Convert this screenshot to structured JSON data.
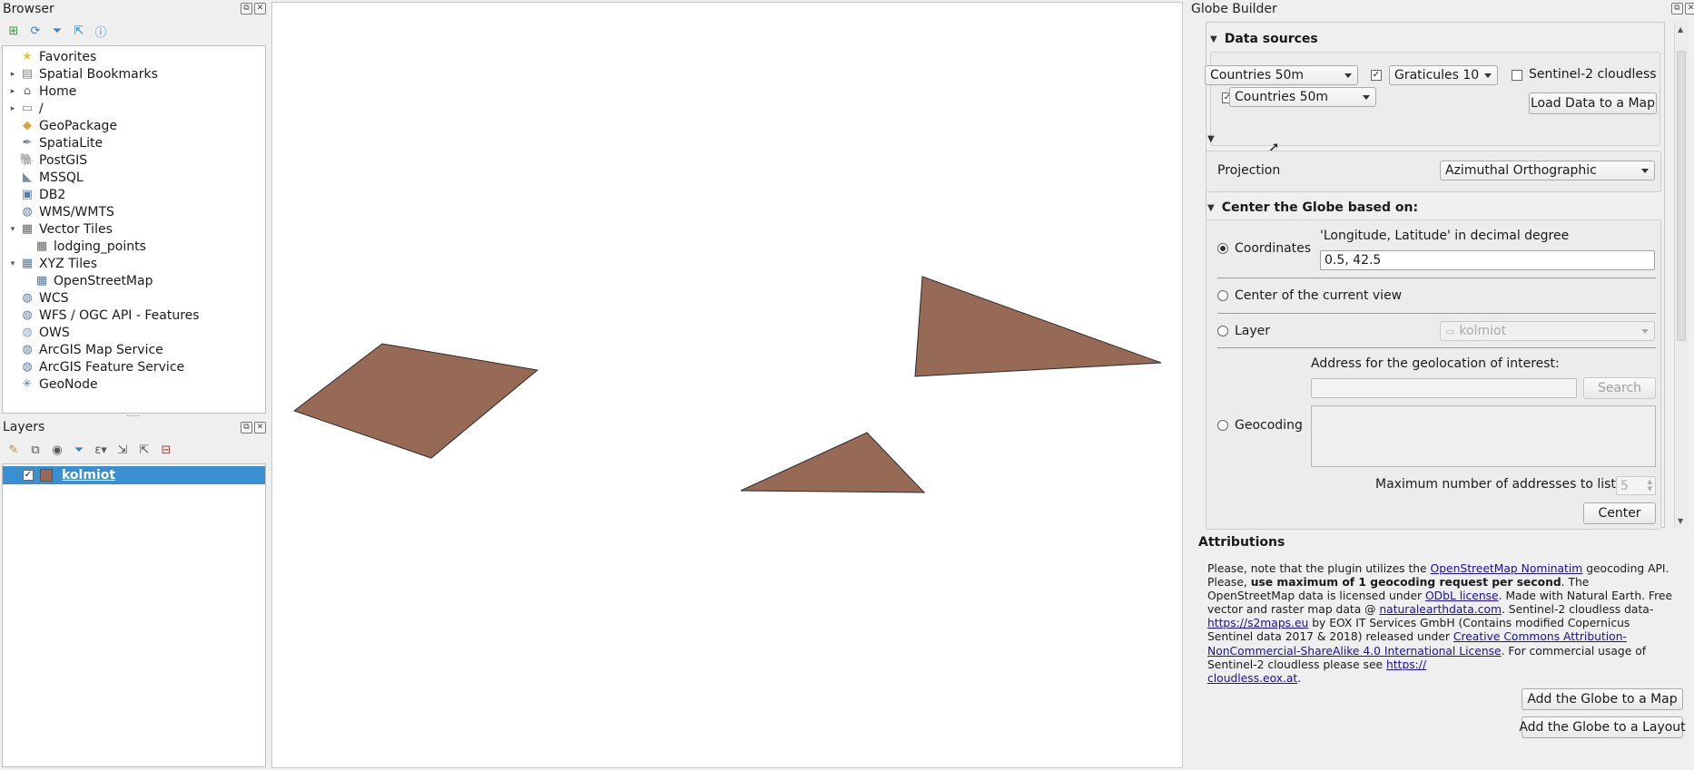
{
  "browser": {
    "title": "Browser",
    "items": [
      {
        "label": "Favorites",
        "icon": "star-icon",
        "glyph": "★",
        "color": "#e8c23a",
        "arrow": ""
      },
      {
        "label": "Spatial Bookmarks",
        "icon": "bookmark-icon",
        "glyph": "▤",
        "color": "#888",
        "arrow": "▸"
      },
      {
        "label": "Home",
        "icon": "home-icon",
        "glyph": "⌂",
        "color": "#666",
        "arrow": "▸"
      },
      {
        "label": "/",
        "icon": "folder-icon",
        "glyph": "▭",
        "color": "#888",
        "arrow": "▸"
      },
      {
        "label": "GeoPackage",
        "icon": "geopackage-icon",
        "glyph": "◆",
        "color": "#d9a441",
        "arrow": ""
      },
      {
        "label": "SpatiaLite",
        "icon": "spatialite-icon",
        "glyph": "✒",
        "color": "#6a7fa8",
        "arrow": ""
      },
      {
        "label": "PostGIS",
        "icon": "postgis-icon",
        "glyph": "🐘",
        "color": "#4a6b8f",
        "arrow": ""
      },
      {
        "label": "MSSQL",
        "icon": "mssql-icon",
        "glyph": "◣",
        "color": "#7a8aa0",
        "arrow": ""
      },
      {
        "label": "DB2",
        "icon": "db2-icon",
        "glyph": "▣",
        "color": "#5a7ca8",
        "arrow": ""
      },
      {
        "label": "WMS/WMTS",
        "icon": "wms-globe-icon",
        "glyph": "◍",
        "color": "#5b7a9c",
        "arrow": ""
      },
      {
        "label": "Vector Tiles",
        "icon": "vector-tiles-icon",
        "glyph": "▦",
        "color": "#666",
        "arrow": "▾"
      },
      {
        "label": "lodging_points",
        "icon": "vector-tile-layer-icon",
        "glyph": "▦",
        "color": "#666",
        "arrow": "",
        "indent": true
      },
      {
        "label": "XYZ Tiles",
        "icon": "xyz-tiles-icon",
        "glyph": "▦",
        "color": "#5b7a9c",
        "arrow": "▾"
      },
      {
        "label": "OpenStreetMap",
        "icon": "xyz-tile-layer-icon",
        "glyph": "▦",
        "color": "#5b7a9c",
        "arrow": "",
        "indent": true
      },
      {
        "label": "WCS",
        "icon": "wcs-globe-icon",
        "glyph": "◍",
        "color": "#5b7a9c",
        "arrow": ""
      },
      {
        "label": "WFS / OGC API - Features",
        "icon": "wfs-icon",
        "glyph": "◍",
        "color": "#5b7a9c",
        "arrow": ""
      },
      {
        "label": "OWS",
        "icon": "ows-globe-icon",
        "glyph": "◍",
        "color": "#8aa0b8",
        "arrow": ""
      },
      {
        "label": "ArcGIS Map Service",
        "icon": "arcgis-map-icon",
        "glyph": "◍",
        "color": "#5b7a9c",
        "arrow": ""
      },
      {
        "label": "ArcGIS Feature Service",
        "icon": "arcgis-feature-icon",
        "glyph": "◍",
        "color": "#5b7a9c",
        "arrow": ""
      },
      {
        "label": "GeoNode",
        "icon": "geonode-icon",
        "glyph": "✳",
        "color": "#5b7a9c",
        "arrow": ""
      }
    ]
  },
  "layers": {
    "title": "Layers",
    "items": [
      {
        "label": "kolmiot",
        "checked": true,
        "selected": true,
        "swatch": "#976a55"
      }
    ]
  },
  "map": {
    "polygon_fill": "#976a55",
    "polygon_stroke": "#2b2b2b"
  },
  "globe": {
    "title": "Globe Builder",
    "data_sources": {
      "heading": "Data sources",
      "countries": {
        "checked": true,
        "value": "Countries 50m"
      },
      "graticules": {
        "checked": true,
        "value": "Graticules 10"
      },
      "sentinel": {
        "checked": false,
        "label": "Sentinel-2 cloudless"
      },
      "load_button": "Load Data to a Map"
    },
    "projection": {
      "label": "Projection",
      "value": "Azimuthal Orthographic"
    },
    "center": {
      "heading": "Center the Globe based on:",
      "coords_hint": "'Longitude, Latitude' in decimal degree",
      "coordinates_label": "Coordinates",
      "coordinates_value": "0.5, 42.5",
      "current_view_label": "Center of the current view",
      "layer_label": "Layer",
      "layer_value": "kolmiot",
      "address_label": "Address for the geolocation of interest:",
      "search_button": "Search",
      "geocoding_label": "Geocoding",
      "max_label": "Maximum number of addresses to list:",
      "max_value": "5",
      "center_button": "Center",
      "selected": "coordinates"
    },
    "attributions": {
      "heading": "Attributions"
    },
    "add_map_button": "Add the Globe to a Map",
    "add_layout_button": "Add the Globe to a Layout"
  },
  "colors": {
    "selection": "#3a8fd0",
    "link": "#1a0dab"
  }
}
